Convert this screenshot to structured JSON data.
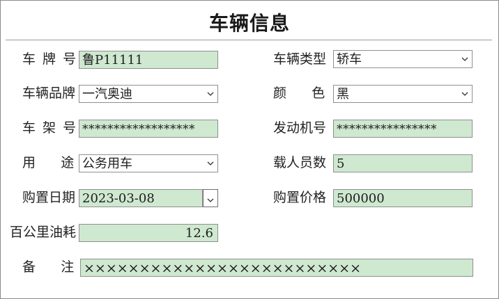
{
  "form": {
    "title": "车辆信息"
  },
  "fields": {
    "plate": {
      "label": "车 牌 号",
      "value": "鲁P11111"
    },
    "type": {
      "label": "车辆类型",
      "value": "轿车"
    },
    "brand": {
      "label": "车辆品牌",
      "value": "一汽奥迪"
    },
    "color": {
      "label": "颜      色",
      "value": "黑"
    },
    "frame_no": {
      "label": "车 架 号",
      "value": "******************"
    },
    "engine_no": {
      "label": "发动机号",
      "value": "****************"
    },
    "usage": {
      "label": "用      途",
      "value": "公务用车"
    },
    "seats": {
      "label": "载人员数",
      "value": "5"
    },
    "purchase_date": {
      "label": "购置日期",
      "value": "2023-03-08"
    },
    "price": {
      "label": "购置价格",
      "value": "500000"
    },
    "fuel": {
      "label": "百公里油耗",
      "value": "12.6"
    },
    "remark": {
      "label": "备      注",
      "value": "×××××××××××××××××××××××××"
    }
  },
  "colors": {
    "field_fill": "#cfe8d0",
    "border": "#8f8f8f"
  },
  "icons": {
    "dropdown": "chevron-down-icon"
  }
}
